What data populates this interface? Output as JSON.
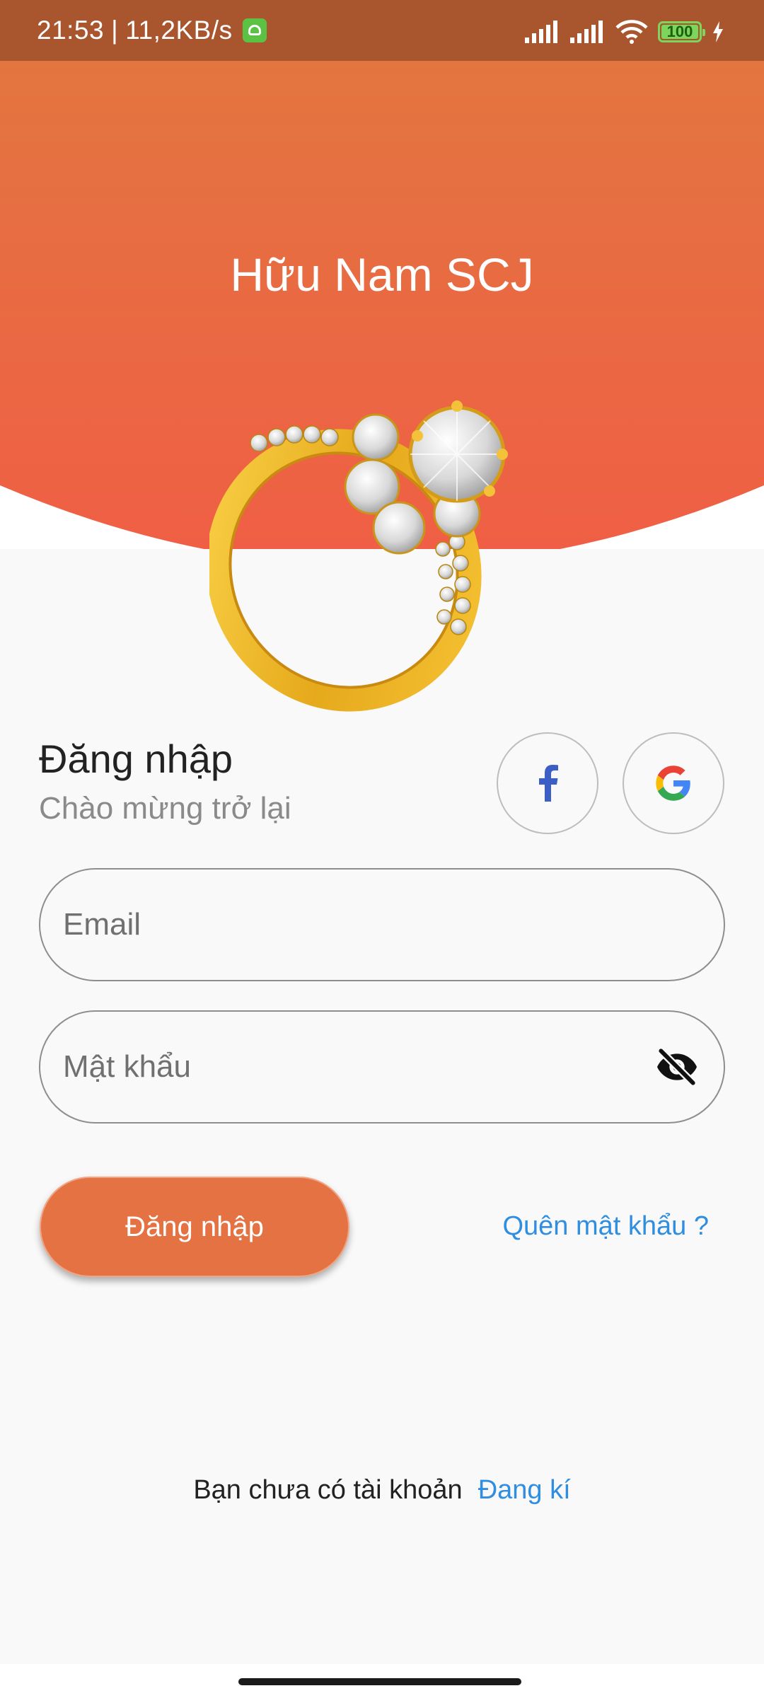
{
  "status_bar": {
    "time": "21:53",
    "separator": "|",
    "net_speed": "11,2KB/s",
    "battery_level": "100",
    "icons": [
      "signal-icon",
      "signal-icon",
      "wifi-icon",
      "battery-icon",
      "charging-icon"
    ]
  },
  "header": {
    "title": "Hữu Nam SCJ",
    "gradient_top": "#e37540",
    "gradient_bottom": "#f05e45"
  },
  "login": {
    "title": "Đăng nhập",
    "subtitle": "Chào mừng trở lại",
    "social": [
      "facebook-icon",
      "google-icon"
    ]
  },
  "form": {
    "email_placeholder": "Email",
    "email_value": "",
    "password_placeholder": "Mật khẩu",
    "password_value": "",
    "password_toggle_icon": "eye-off-icon"
  },
  "actions": {
    "login_button": "Đăng nhập",
    "forgot_password": "Quên mật khẩu ?",
    "accent_color": "#e47243",
    "link_color": "#2f8ee0"
  },
  "signup": {
    "prompt": "Bạn chưa có tài khoản",
    "link": "Đang kí"
  }
}
